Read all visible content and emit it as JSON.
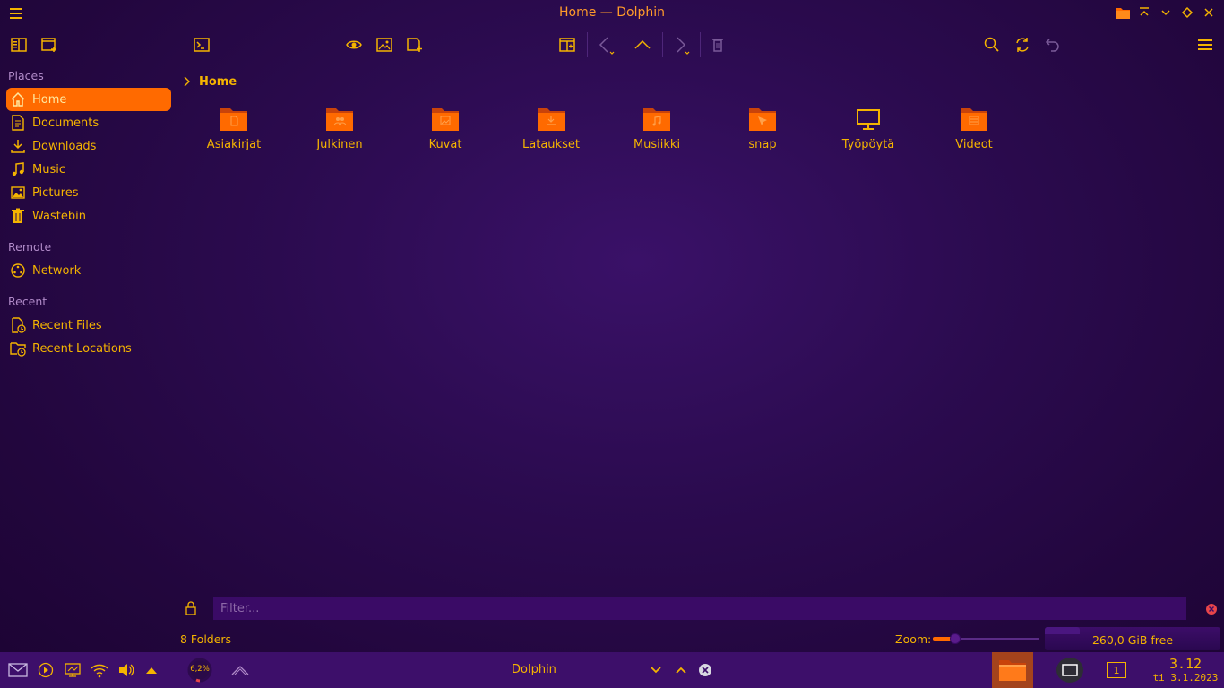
{
  "window": {
    "title": "Home — Dolphin"
  },
  "colors": {
    "accent": "#ff6a00",
    "text": "#f5b400",
    "background": "#2b0b4f",
    "folder": "#ff6a00"
  },
  "toolbar": {
    "icons": [
      "places-panel-icon",
      "new-tab-icon",
      "terminal-icon",
      "preview-icon",
      "image-view-icon",
      "new-folder-icon",
      "split-view-icon",
      "back-icon",
      "up-icon",
      "forward-icon",
      "trash-icon",
      "search-icon",
      "reload-icon",
      "undo-icon",
      "hamburger-menu-icon"
    ]
  },
  "sidebar": {
    "sections": [
      {
        "title": "Places",
        "items": [
          {
            "label": "Home",
            "icon": "home-icon",
            "active": true
          },
          {
            "label": "Documents",
            "icon": "document-icon"
          },
          {
            "label": "Downloads",
            "icon": "download-icon"
          },
          {
            "label": "Music",
            "icon": "music-icon"
          },
          {
            "label": "Pictures",
            "icon": "picture-icon"
          },
          {
            "label": "Wastebin",
            "icon": "trash-icon"
          }
        ]
      },
      {
        "title": "Remote",
        "items": [
          {
            "label": "Network",
            "icon": "network-icon"
          }
        ]
      },
      {
        "title": "Recent",
        "items": [
          {
            "label": "Recent Files",
            "icon": "recent-files-icon"
          },
          {
            "label": "Recent Locations",
            "icon": "recent-locations-icon"
          }
        ]
      }
    ]
  },
  "breadcrumb": {
    "current": "Home"
  },
  "folders": [
    {
      "name": "Asiakirjat",
      "icon": "documents-folder-icon"
    },
    {
      "name": "Julkinen",
      "icon": "public-folder-icon"
    },
    {
      "name": "Kuvat",
      "icon": "pictures-folder-icon"
    },
    {
      "name": "Lataukset",
      "icon": "downloads-folder-icon"
    },
    {
      "name": "Musiikki",
      "icon": "music-folder-icon"
    },
    {
      "name": "snap",
      "icon": "snap-folder-icon"
    },
    {
      "name": "Työpöytä",
      "icon": "desktop-icon"
    },
    {
      "name": "Videot",
      "icon": "videos-folder-icon"
    }
  ],
  "filter": {
    "placeholder": "Filter..."
  },
  "status": {
    "summary": "8 Folders",
    "zoom_label": "Zoom:",
    "zoom_level": 0.18,
    "free_space": "260,0 GiB free",
    "used_fraction": 0.2
  },
  "taskbar": {
    "cpu": "6,2%",
    "active_window": "Dolphin",
    "pager": "1",
    "time": "3.12",
    "date": "ti 3.1.2023"
  }
}
